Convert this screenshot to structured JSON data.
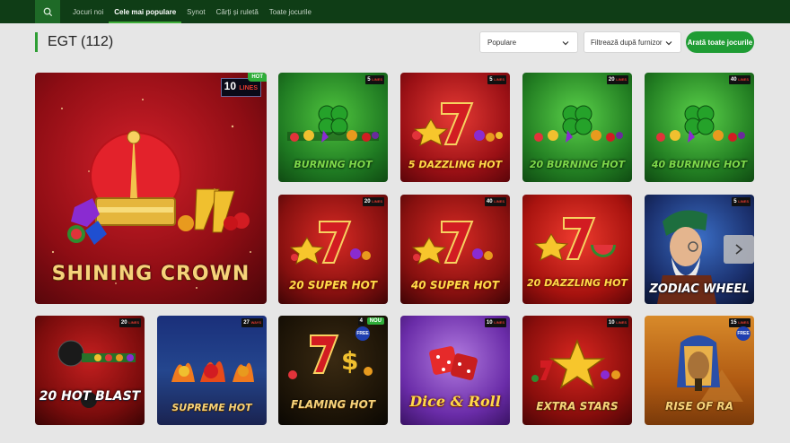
{
  "nav": {
    "items": [
      {
        "label": "Jocuri noi",
        "active": false
      },
      {
        "label": "Cele mai populare",
        "active": true
      },
      {
        "label": "Synot",
        "active": false
      },
      {
        "label": "Cărți și ruletă",
        "active": false
      },
      {
        "label": "Toate jocurile",
        "active": false
      }
    ]
  },
  "header": {
    "title": "EGT (112)",
    "sort_value": "Populare",
    "provider_placeholder": "Filtrează după furnizor",
    "show_all_label": "Arată toate jocurile"
  },
  "featured": {
    "name": "SHINING CROWN",
    "lines": "10",
    "lines_word": "LINES",
    "badge": "HOT"
  },
  "games": [
    {
      "name": "BURNING HOT",
      "lines": "5",
      "lines_word": "LINES"
    },
    {
      "name": "5 DAZZLING HOT",
      "lines": "5",
      "lines_word": "LINES"
    },
    {
      "name": "20 BURNING HOT",
      "lines": "20",
      "lines_word": "LINES"
    },
    {
      "name": "40 BURNING HOT",
      "lines": "40",
      "lines_word": "LINES"
    },
    {
      "name": "20 SUPER HOT",
      "lines": "20",
      "lines_word": "LINES"
    },
    {
      "name": "40 SUPER HOT",
      "lines": "40",
      "lines_word": "LINES"
    },
    {
      "name": "20 DAZZLING HOT",
      "lines": "",
      "lines_word": ""
    },
    {
      "name": "ZODIAC WHEEL",
      "lines": "5",
      "lines_word": "LINES"
    },
    {
      "name": "20 HOT BLAST",
      "lines": "20",
      "lines_word": "LINES"
    },
    {
      "name": "SUPREME HOT",
      "lines": "27",
      "lines_word": "WAYS"
    },
    {
      "name": "FLAMING HOT",
      "lines": "4",
      "lines_word": "",
      "badge": "NOU",
      "free": "FREE"
    },
    {
      "name": "Dice & Roll",
      "lines": "10",
      "lines_word": "LINES"
    },
    {
      "name": "EXTRA STARS",
      "lines": "10",
      "lines_word": "LINES"
    },
    {
      "name": "RISE OF RA",
      "lines": "15",
      "lines_word": "LINES",
      "free": "FREE"
    }
  ],
  "colors": {
    "nav_bg": "#0f3d16",
    "accent_green": "#2e9e34",
    "button_green": "#1f9c34",
    "page_bg": "#e6e6e6"
  },
  "icons": [
    "search-icon",
    "chevron-down-icon",
    "chevron-right-icon"
  ]
}
